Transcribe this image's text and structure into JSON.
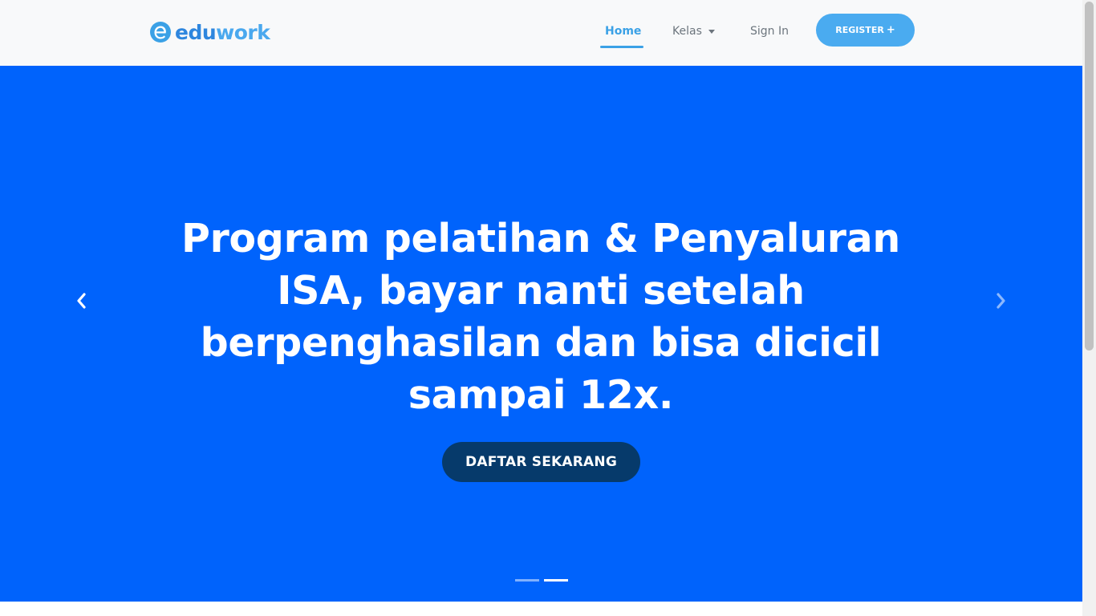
{
  "navbar": {
    "logo": {
      "prefix": "edu",
      "suffix": "work",
      "icon": "eduwork-logo-icon"
    },
    "links": {
      "home": "Home",
      "kelas": "Kelas",
      "signin": "Sign In"
    },
    "register_label": "REGISTER",
    "register_icon": "plus-icon",
    "active_color": "#3ba1e6"
  },
  "hero": {
    "title": "Program pelatihan & Penyaluran ISA, bayar nanti setelah berpenghasilan dan bisa dicicil sampai 12x.",
    "cta_label": "DAFTAR SEKARANG",
    "background_color": "#0063fc",
    "cta_color": "#063a6b",
    "prev_icon": "chevron-left-icon",
    "next_icon": "chevron-right-icon",
    "slides_total": 2,
    "active_slide": 2
  }
}
